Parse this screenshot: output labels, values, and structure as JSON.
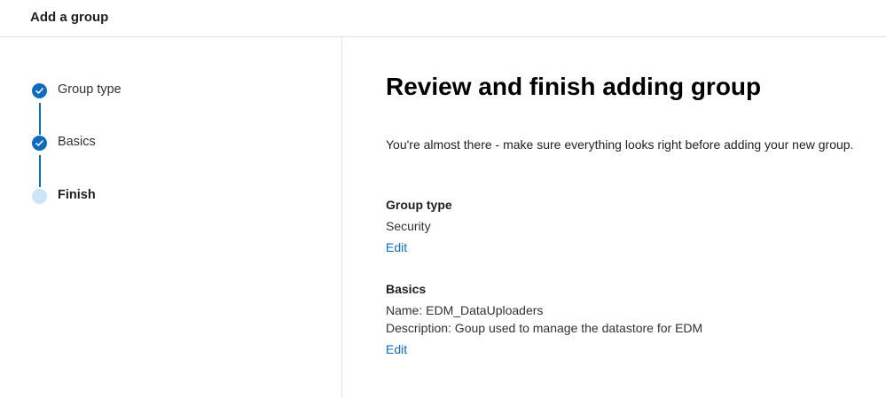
{
  "header": {
    "title": "Add a group"
  },
  "wizard": {
    "steps": [
      {
        "label": "Group type",
        "status": "completed"
      },
      {
        "label": "Basics",
        "status": "completed"
      },
      {
        "label": "Finish",
        "status": "current"
      }
    ]
  },
  "main": {
    "title": "Review and finish adding group",
    "intro": "You're almost there - make sure everything looks right before adding your new group.",
    "sections": [
      {
        "heading": "Group type",
        "lines": [
          "Security"
        ],
        "edit_label": "Edit"
      },
      {
        "heading": "Basics",
        "lines": [
          "Name: EDM_DataUploaders",
          "Description: Goup used to manage the datastore for EDM"
        ],
        "edit_label": "Edit"
      }
    ]
  },
  "colors": {
    "accent": "#0f6cbd",
    "pending_step": "#cfe4fa",
    "divider": "#e1dfdd"
  }
}
